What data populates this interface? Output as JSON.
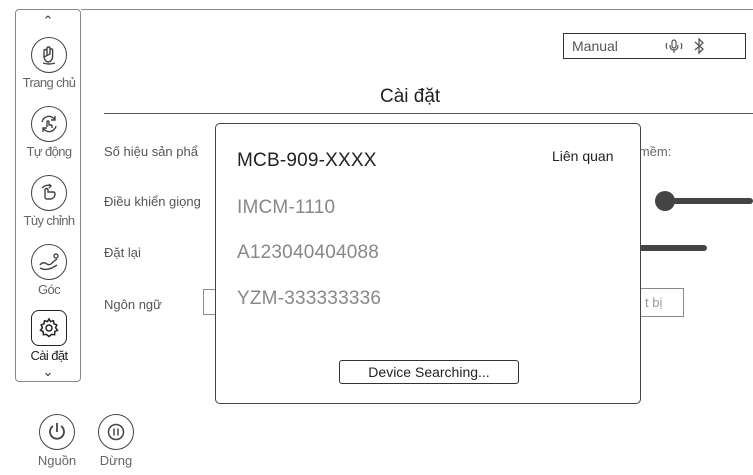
{
  "nav": {
    "items": [
      {
        "label": "Trang chủ",
        "icon": "hand-icon"
      },
      {
        "label": "Tự động",
        "icon": "auto-cycle-icon"
      },
      {
        "label": "Tùy chỉnh",
        "icon": "custom-hand-icon"
      },
      {
        "label": "Góc",
        "icon": "recline-icon"
      },
      {
        "label": "Cài đặt",
        "icon": "gear-icon"
      }
    ],
    "active": "Cài đặt"
  },
  "header": {
    "mode": "Manual",
    "icons": [
      "microphone-icon",
      "bluetooth-icon"
    ]
  },
  "page": {
    "title": "Cài đặt",
    "rows": {
      "serial": "Số hiệu sản phẩ",
      "voice": "Điều khiển giọng",
      "reset": "Đặt lại",
      "language": "Ngôn ngữ"
    },
    "software_fragment": "n mềm:",
    "device_fragment": "t bị"
  },
  "modal": {
    "devices": [
      "MCB-909-XXXX",
      "IMCM-1110",
      "A123040404088",
      "YZM-333333336"
    ],
    "related_label": "Liên quan",
    "search_button": "Device Searching..."
  },
  "bottom": {
    "power_label": "Nguồn",
    "pause_label": "Dừng"
  },
  "colors": {
    "stroke": "#444444",
    "text": "#555555"
  }
}
